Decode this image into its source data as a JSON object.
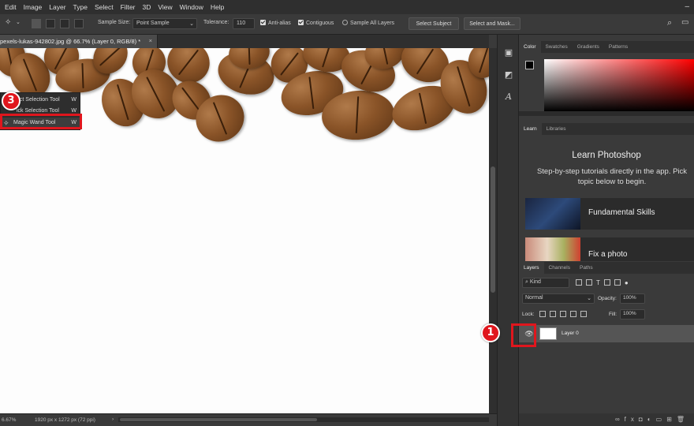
{
  "menubar": {
    "items": [
      "Edit",
      "Image",
      "Layer",
      "Type",
      "Select",
      "Filter",
      "3D",
      "View",
      "Window",
      "Help"
    ]
  },
  "options_bar": {
    "sample_size_label": "Sample Size:",
    "sample_size_value": "Point Sample",
    "tolerance_label": "Tolerance:",
    "tolerance_value": "110",
    "anti_alias_label": "Anti-alias",
    "contiguous_label": "Contiguous",
    "sample_all_layers_label": "Sample All Layers",
    "select_subject_label": "Select Subject",
    "select_and_mask_label": "Select and Mask..."
  },
  "document": {
    "tab_title": "pexels-lukas-942802.jpg @ 66.7% (Layer 0, RGB/8) *",
    "close_glyph": "×"
  },
  "statusbar": {
    "zoom": "6.67%",
    "doc_info": "1920 px x 1272 px (72 ppi)"
  },
  "tool_flyout": {
    "items": [
      {
        "label": "ect Selection Tool",
        "key": "W"
      },
      {
        "label": "ick Selection Tool",
        "key": "W"
      },
      {
        "label": "Magic Wand Tool",
        "key": "W"
      }
    ]
  },
  "color_panel": {
    "tabs": [
      "Color",
      "Swatches",
      "Gradients",
      "Patterns"
    ],
    "foreground": "#000000",
    "background": "#ffffff",
    "hue": "#ff0000"
  },
  "learn_panel": {
    "tabs": [
      "Learn",
      "Libraries"
    ],
    "title": "Learn Photoshop",
    "description": "Step-by-step tutorials directly in the app. Pick topic below to begin.",
    "cards": [
      {
        "label": "Fundamental Skills"
      },
      {
        "label": "Fix a photo"
      }
    ]
  },
  "layers_panel": {
    "tabs": [
      "Layers",
      "Channels",
      "Paths"
    ],
    "kind_label": "Kind",
    "blend_mode": "Normal",
    "opacity_label": "Opacity:",
    "opacity_value": "100%",
    "lock_label": "Lock:",
    "fill_label": "Fill:",
    "fill_value": "100%",
    "layer_name": "Layer 0"
  },
  "markers": {
    "step1": "1",
    "step3": "3"
  },
  "colors": {
    "annotation_red": "#e0161d",
    "app_bg": "#3a3a3a"
  }
}
